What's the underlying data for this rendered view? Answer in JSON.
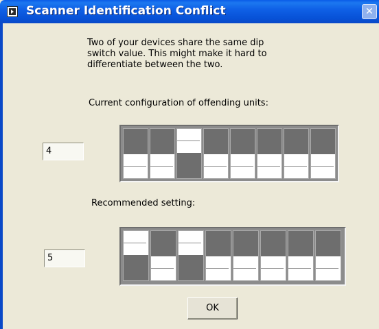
{
  "window": {
    "title": "Scanner Identification Conflict",
    "close_glyph": "✕"
  },
  "message": "Two of your devices share the same dip switch value.  This might make it hard to differentiate between the two.",
  "current": {
    "label": "Current configuration of offending units:",
    "value": "4",
    "switches": [
      "down",
      "down",
      "up",
      "down",
      "down",
      "down",
      "down",
      "down"
    ]
  },
  "recommended": {
    "label": "Recommended setting:",
    "value": "5",
    "switches": [
      "up",
      "down",
      "up",
      "down",
      "down",
      "down",
      "down",
      "down"
    ]
  },
  "ok_label": "OK",
  "icons": {
    "app": "labview-app-icon",
    "close": "close-icon"
  },
  "colors": {
    "titlebar": "#0a5ce8",
    "window_bg": "#ece9d8",
    "switch_dark": "#6e6e6e",
    "switch_light": "#ffffff"
  }
}
